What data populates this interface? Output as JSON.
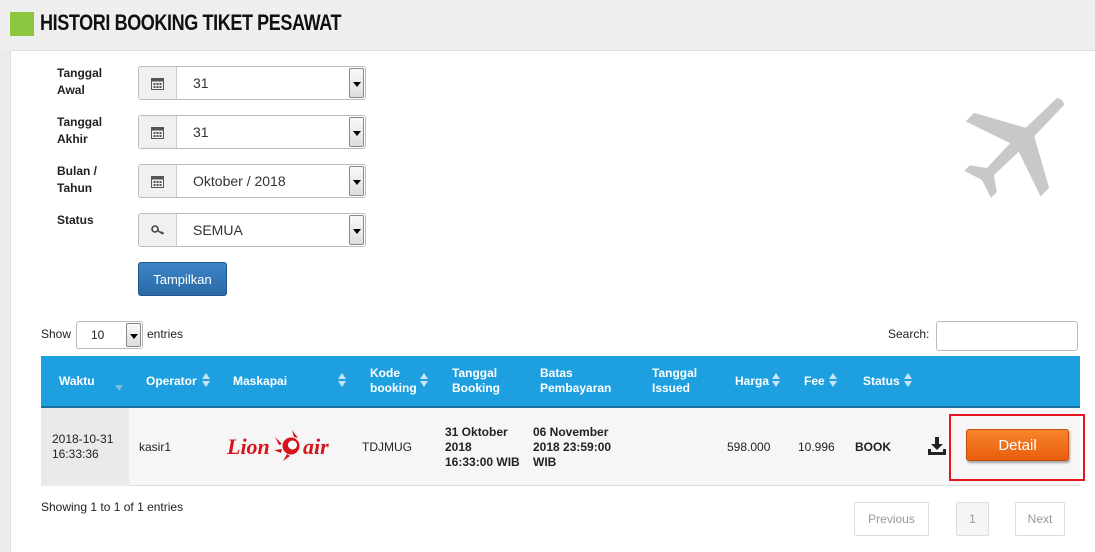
{
  "header": {
    "title": "HISTORI BOOKING TIKET PESAWAT",
    "accent_color": "#8dc63f"
  },
  "form": {
    "tanggal_awal": {
      "label": "Tanggal Awal",
      "value": "31",
      "icon": "calendar-icon"
    },
    "tanggal_akhir": {
      "label": "Tanggal Akhir",
      "value": "31",
      "icon": "calendar-icon"
    },
    "bulan_tahun": {
      "label": "Bulan / Tahun",
      "value": "Oktober / 2018",
      "icon": "calendar-icon"
    },
    "status": {
      "label": "Status",
      "value": "SEMUA",
      "icon": "key-icon"
    },
    "submit_label": "Tampilkan"
  },
  "decoration": {
    "icon": "airplane-icon"
  },
  "table_controls": {
    "show_label": "Show",
    "length_value": "10",
    "entries_label": "entries",
    "search_label": "Search:",
    "search_value": ""
  },
  "table": {
    "header_color": "#1ea0e0",
    "columns": {
      "waktu": "Waktu",
      "operator": "Operator",
      "maskapai": "Maskapai",
      "kode_booking": "Kode booking",
      "tanggal_booking": "Tanggal Booking",
      "batas_pembayaran": "Batas Pembayaran",
      "tanggal_issued": "Tanggal Issued",
      "harga": "Harga",
      "fee": "Fee",
      "status": "Status"
    },
    "rows": [
      {
        "waktu_date": "2018-10-31",
        "waktu_time": "16:33:36",
        "operator": "kasir1",
        "maskapai_logo": "Lion air",
        "kode_booking": "TDJMUG",
        "tanggal_booking": "31 Oktober 2018 16:33:00 WIB",
        "batas_pembayaran": "06 November 2018 23:59:00 WIB",
        "tanggal_issued": "",
        "harga": "598.000",
        "fee": "10.996",
        "status": "BOOK",
        "download_icon": "download-icon",
        "detail_label": "Detail"
      }
    ]
  },
  "footer": {
    "info": "Showing 1 to 1 of 1 entries",
    "previous": "Previous",
    "page": "1",
    "next": "Next"
  },
  "colors": {
    "detail_button": "#f07020",
    "highlight_border": "#e8141d",
    "logo_red": "#d7141b"
  }
}
